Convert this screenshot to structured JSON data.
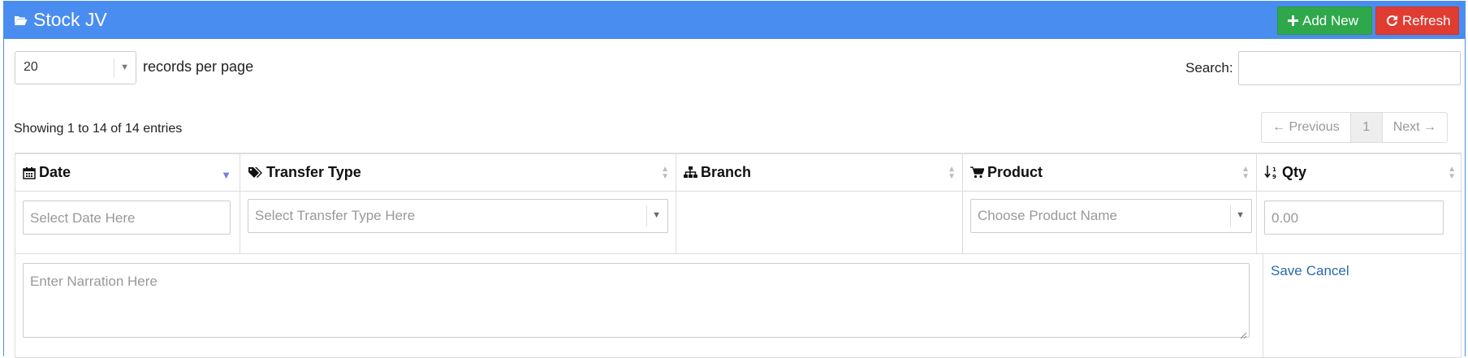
{
  "header": {
    "title": "Stock JV",
    "title_icon": "folder-open-icon",
    "add_button": "Add New",
    "refresh_button": "Refresh",
    "colors": {
      "header_bg": "#4a8df0",
      "add_bg": "#2ea84b",
      "refresh_bg": "#e03c32"
    }
  },
  "length": {
    "value": "20",
    "label": "records per page"
  },
  "search": {
    "label": "Search:",
    "value": ""
  },
  "info": "Showing 1 to 14 of 14 entries",
  "pagination": {
    "previous": "← Previous",
    "page": "1",
    "next": "Next →"
  },
  "columns": [
    {
      "label": "Date",
      "icon": "calendar-icon"
    },
    {
      "label": "Transfer Type",
      "icon": "tags-icon"
    },
    {
      "label": "Branch",
      "icon": "sitemap-icon"
    },
    {
      "label": "Product",
      "icon": "shopping-cart-icon"
    },
    {
      "label": "Qty",
      "icon": "sort-numeric-icon"
    }
  ],
  "form": {
    "date_placeholder": "Select Date Here",
    "transfer_placeholder": "Select Transfer Type Here",
    "product_placeholder": "Choose Product Name",
    "qty_placeholder": "0.00",
    "narration_placeholder": "Enter Narration Here",
    "save": "Save",
    "cancel": "Cancel"
  }
}
